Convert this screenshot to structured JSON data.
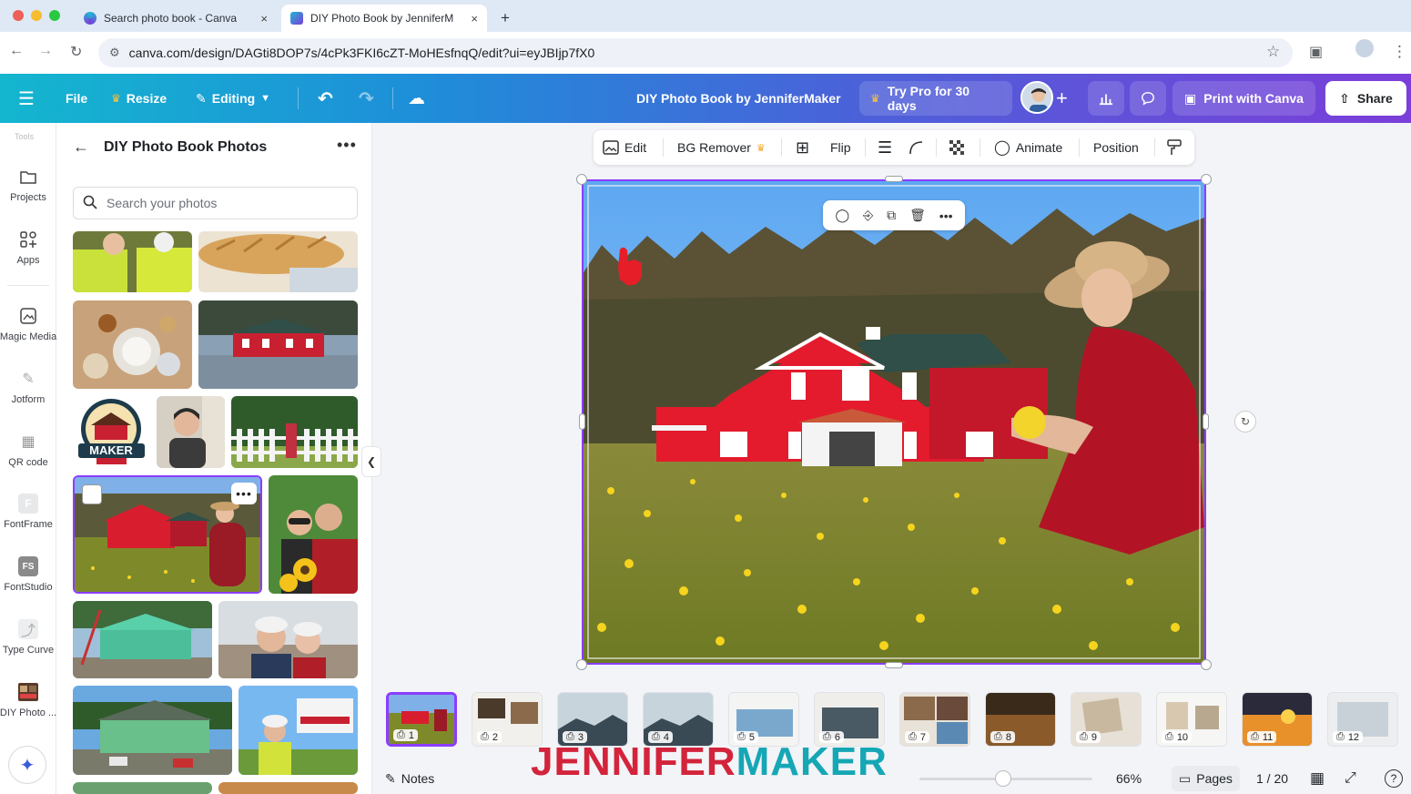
{
  "browser": {
    "tabs": [
      {
        "title": "Search photo book - Canva",
        "close": "×"
      },
      {
        "title": "DIY Photo Book by JenniferM",
        "close": "×"
      }
    ],
    "new_tab": "+",
    "url": "canva.com/design/DAGti8DOP7s/4cPk3FKI6cZT-MoHEsfnqQ/edit?ui=eyJBIjp7fX0"
  },
  "header": {
    "menu_icon": "menu-icon",
    "file": "File",
    "resize": "Resize",
    "editing": "Editing",
    "doc_title": "DIY Photo Book by JenniferMaker",
    "try_pro": "Try Pro for 30 days",
    "print": "Print with Canva",
    "share": "Share",
    "colors": {
      "gradient_start": "#14b6cf",
      "gradient_end": "#7b3ed9",
      "crown": "#f6c244"
    }
  },
  "rail": {
    "top_label": "Tools",
    "items": [
      {
        "label": "Projects",
        "icon": "folder-icon"
      },
      {
        "label": "Apps",
        "icon": "apps-icon"
      },
      {
        "label": "Magic Media",
        "icon": "magic-media-icon"
      },
      {
        "label": "Jotform",
        "icon": "jotform-icon"
      },
      {
        "label": "QR code",
        "icon": "qr-code-icon"
      },
      {
        "label": "FontFrame",
        "icon": "fontframe-icon"
      },
      {
        "label": "FontStudio",
        "icon": "fontstudio-icon"
      },
      {
        "label": "Type Curve",
        "icon": "type-curve-icon"
      },
      {
        "label": "DIY Photo ...",
        "icon": "diy-photo-icon"
      }
    ]
  },
  "panel": {
    "title": "DIY Photo Book Photos",
    "search_placeholder": "Search your photos"
  },
  "toolbar": {
    "edit": "Edit",
    "bg_remover": "BG Remover",
    "flip": "Flip",
    "animate": "Animate",
    "position": "Position"
  },
  "pages": {
    "labels": [
      "1",
      "2",
      "3",
      "4",
      "5",
      "6",
      "7",
      "8",
      "9",
      "10",
      "11",
      "12"
    ],
    "current": 1,
    "total": 20
  },
  "bottom": {
    "notes": "Notes",
    "zoom": "66%",
    "pages_label": "Pages",
    "page_indicator": "1 / 20"
  },
  "watermark": {
    "part1": "JENNIFER",
    "part2": "MAKER"
  },
  "accent": "#8b3dff"
}
